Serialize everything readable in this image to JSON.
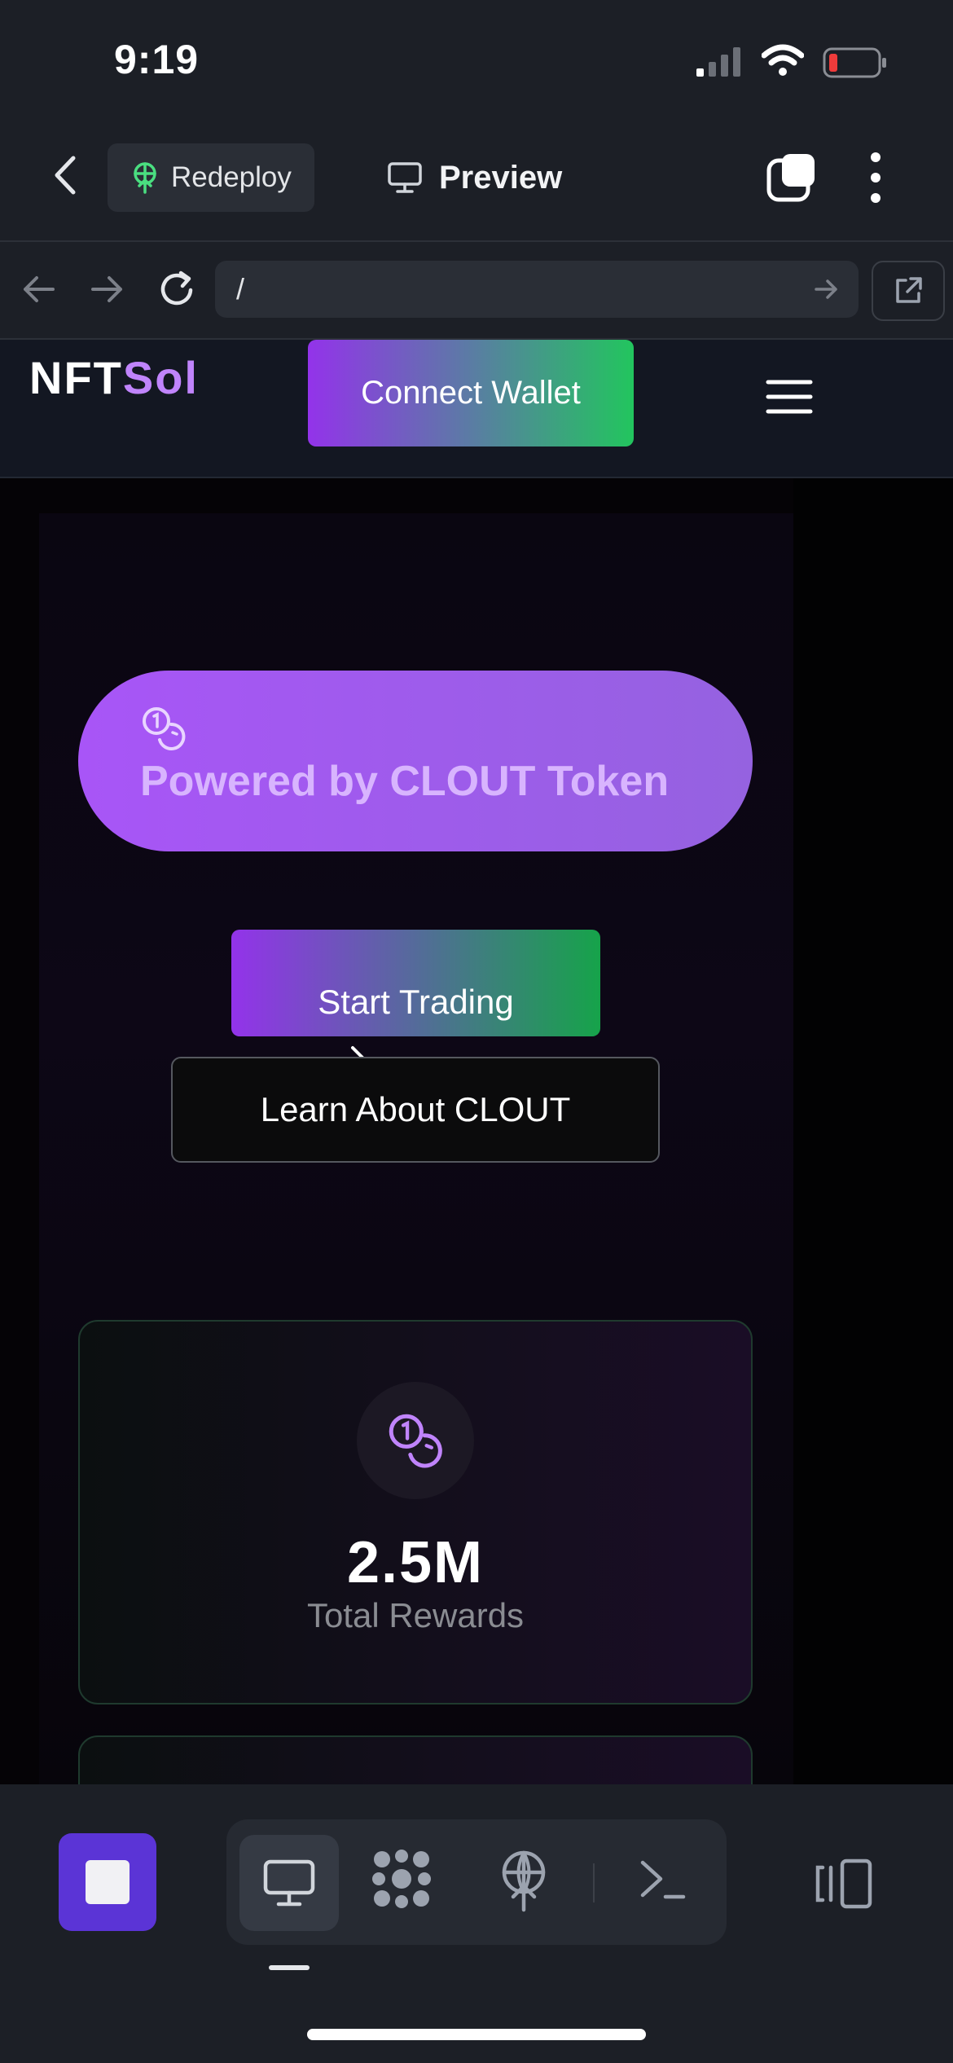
{
  "status_bar": {
    "time": "9:19"
  },
  "app_bar": {
    "redeploy_label": "Redeploy",
    "preview_label": "Preview"
  },
  "address_bar": {
    "url": "/"
  },
  "site": {
    "logo_part1": "NFT",
    "logo_part2": "Sol",
    "connect_label": "Connect Wallet",
    "hero": {
      "badge_text": "Powered by CLOUT Token",
      "start_label": "Start Trading",
      "learn_label": "Learn About CLOUT"
    },
    "stats": [
      {
        "value": "2.5M",
        "label": "Total Rewards",
        "icon": "coins-icon"
      }
    ]
  },
  "colors": {
    "accent_purple": "#9333ea",
    "accent_green": "#22c55e",
    "logo_purple": "#c084fc",
    "stop_button": "#5b34d6"
  }
}
